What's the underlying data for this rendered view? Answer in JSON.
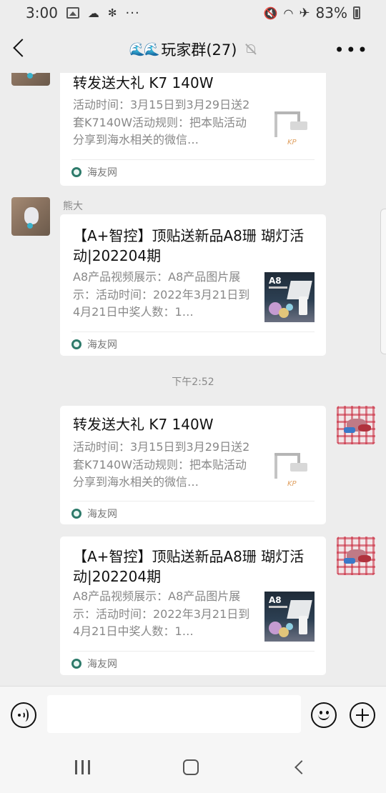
{
  "status_bar": {
    "time": "3:00",
    "more": "···",
    "battery": "83%",
    "icons": [
      "photo-icon",
      "cloud-icon",
      "bluetooth-icon",
      "mute-icon",
      "wifi-icon",
      "airplane-icon",
      "battery-icon"
    ]
  },
  "header": {
    "title_emoji": "🌊🌊",
    "title": "玩家群(27)",
    "muted": true,
    "more": "•••"
  },
  "messages": [
    {
      "side": "left",
      "sender": "",
      "avatar": "bear-avatar",
      "card": {
        "title": "转发送大礼  K7 140W",
        "desc": "活动时间：3月15日到3月29日送2套K7140W活动规则：把本贴活动分享到海水相关的微信…",
        "thumb": "k7-lamp",
        "thumb_logo": "KP",
        "source": "海友网"
      }
    },
    {
      "side": "left",
      "sender": "熊大",
      "avatar": "bear-avatar",
      "card": {
        "title": "【A+智控】顶贴送新品A8珊 瑚灯活动|202204期",
        "desc": "A8产品视频展示：A8产品图片展示：活动时间：2022年3月21日到4月21日中奖人数：1…",
        "thumb": "a8-lamp",
        "thumb_logo": "A8",
        "source": "海友网"
      }
    },
    {
      "timestamp": "下午2:52"
    },
    {
      "side": "right",
      "avatar": "plaid-avatar",
      "card": {
        "title": "转发送大礼  K7 140W",
        "desc": "活动时间：3月15日到3月29日送2套K7140W活动规则：把本贴活动分享到海水相关的微信…",
        "thumb": "k7-lamp",
        "thumb_logo": "KP",
        "source": "海友网"
      }
    },
    {
      "side": "right",
      "avatar": "plaid-avatar",
      "card": {
        "title": "【A+智控】顶贴送新品A8珊 瑚灯活动|202204期",
        "desc": "A8产品视频展示：A8产品图片展示：活动时间：2022年3月21日到4月21日中奖人数：1…",
        "thumb": "a8-lamp",
        "thumb_logo": "A8",
        "source": "海友网"
      }
    }
  ],
  "input_bar": {
    "value": "",
    "icons": [
      "voice-icon",
      "emoji-icon",
      "plus-icon"
    ]
  },
  "system_nav": {
    "icons": [
      "recents-icon",
      "home-icon",
      "back-icon"
    ]
  }
}
